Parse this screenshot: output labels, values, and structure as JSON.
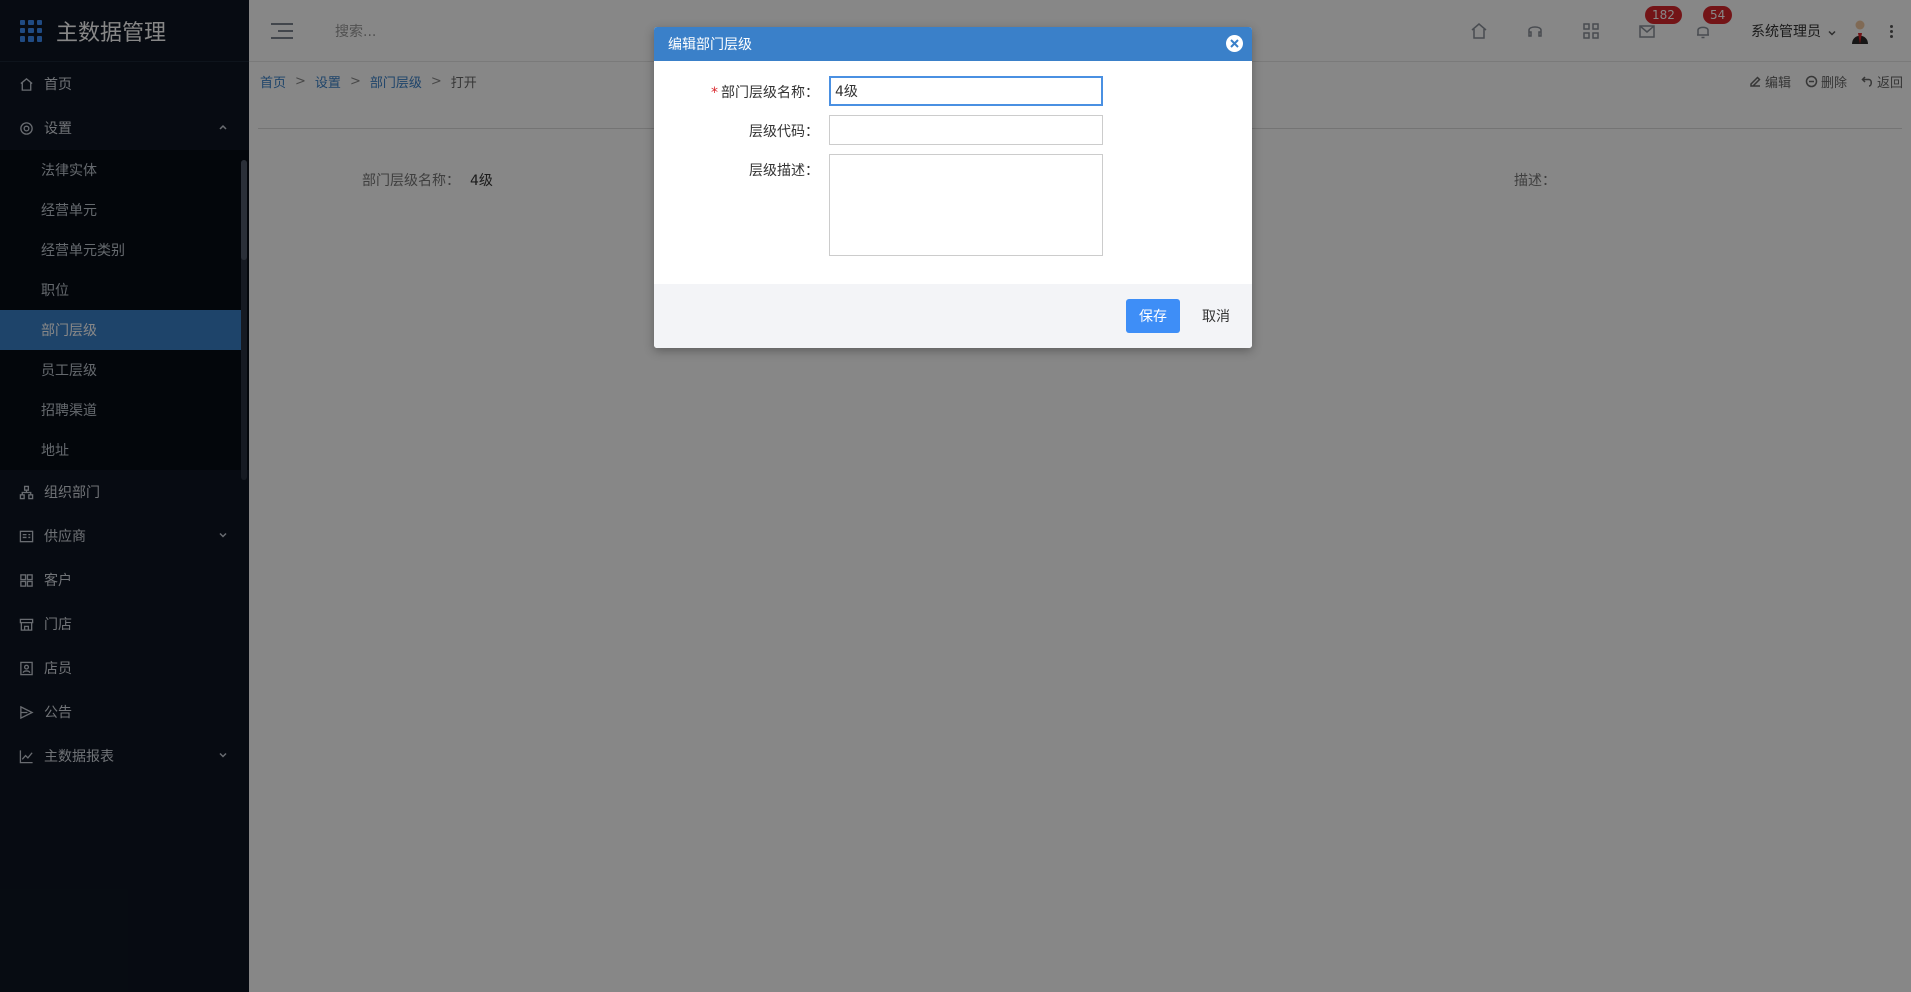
{
  "app": {
    "title": "主数据管理"
  },
  "sidebar": {
    "items": [
      {
        "label": "首页",
        "icon": "home-icon"
      },
      {
        "label": "设置",
        "icon": "settings-icon",
        "expanded": true,
        "children": [
          "法律实体",
          "经营单元",
          "经营单元类别",
          "职位",
          "部门层级",
          "员工层级",
          "招聘渠道",
          "地址"
        ],
        "active_child": "部门层级"
      },
      {
        "label": "组织部门",
        "icon": "org-icon"
      },
      {
        "label": "供应商",
        "icon": "supplier-icon",
        "has_children": true
      },
      {
        "label": "客户",
        "icon": "customer-icon"
      },
      {
        "label": "门店",
        "icon": "store-icon"
      },
      {
        "label": "店员",
        "icon": "clerk-icon"
      },
      {
        "label": "公告",
        "icon": "notice-icon"
      },
      {
        "label": "主数据报表",
        "icon": "report-icon",
        "has_children": true
      }
    ]
  },
  "header": {
    "search_placeholder": "搜索...",
    "badge_messages": "182",
    "badge_notifications": "54",
    "user_name": "系统管理员"
  },
  "breadcrumb": [
    "首页",
    "设置",
    "部门层级",
    "打开"
  ],
  "actions": {
    "edit": "编辑",
    "delete": "删除",
    "back": "返回"
  },
  "detail": {
    "name_label": "部门层级名称：",
    "name_value": "4级",
    "desc_label": "描述："
  },
  "modal": {
    "title": "编辑部门层级",
    "fields": {
      "name_label": "部门层级名称：",
      "name_value": "4级",
      "code_label": "层级代码：",
      "code_value": "",
      "desc_label": "层级描述：",
      "desc_value": ""
    },
    "save_label": "保存",
    "cancel_label": "取消"
  },
  "colors": {
    "accent": "#3a80c9",
    "primary_button": "#3e8ef7",
    "badge": "#d9262c",
    "sidebar_bg": "#0e1622"
  }
}
